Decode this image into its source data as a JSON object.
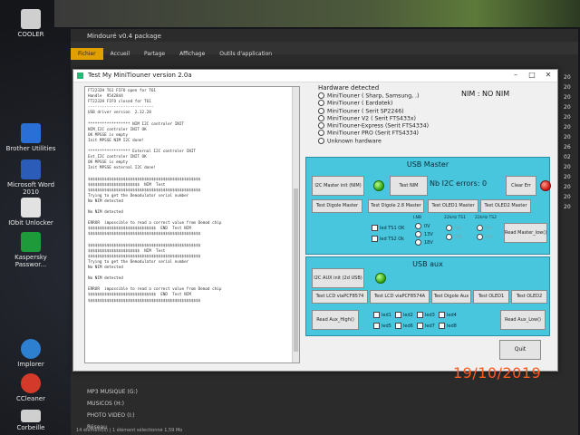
{
  "desktop": {
    "icons": [
      {
        "label": "COOLER",
        "color": "#cfcfcf"
      },
      {
        "label": "Brother Utilities",
        "color": "#2a6fd6"
      },
      {
        "label": "Microsoft Word 2010",
        "color": "#2b5db8"
      },
      {
        "label": "IObit Unlocker",
        "color": "#e2e2e2"
      },
      {
        "label": "Kaspersky Passwor...",
        "color": "#1e9a3a"
      },
      {
        "label": "Implorer",
        "color": "#2d7fd0"
      },
      {
        "label": "CCleaner",
        "color": "#d43a2a"
      },
      {
        "label": "Corbeille",
        "color": "#cfcfcf"
      }
    ]
  },
  "explorer": {
    "title": "Mindouré v0.4 package",
    "tabs": [
      "Fichier",
      "Accueil",
      "Partage",
      "Affichage",
      "Outils d'application"
    ],
    "list": [
      "MP3 MUSIQUE (G:)",
      "MUSICOS (H:)",
      "PHOTO VIDEO (I:)",
      "Réseau"
    ],
    "status": "14 élément(s)  |  1 élément sélectionné  1,59 Mo",
    "right_column": [
      "20",
      "20",
      "20",
      "20",
      "20",
      "20",
      "20",
      "26",
      "02",
      "20",
      "20",
      "20",
      "20",
      "20"
    ]
  },
  "app": {
    "title": "Test My MiniTiouner version 2.0a",
    "log_lines": [
      "FT2232H T61 FIFO open for T61",
      "Handle  9542844",
      "FT2232H FIFO closed for T61",
      "----------------------------",
      "USB driver version  2.12.28",
      "",
      "****************** NIM I2C controler INIT",
      "NIM_I2C controler INIT OK",
      "OK MPSSE is empty",
      "Init MPSSE NIM I2C done!",
      "",
      "****************** External I2C controler INIT",
      "Ext_I2C controler INIT OK",
      "OK MPSSE is empty",
      "Init MPSSE external I2C done!",
      "",
      "$$$$$$$$$$$$$$$$$$$$$$$$$$$$$$$$$$$$$$$$$$$$$$$$",
      "$$$$$$$$$$$$$$$$$$$$$$  NIM  Test",
      "$$$$$$$$$$$$$$$$$$$$$$$$$$$$$$$$$$$$$$$$$$$$$$$$",
      "Trying to get the Demodulator serial number",
      "No NIM detected",
      "",
      "No NIM detected",
      "",
      "ERROR  impossible to read a correct value from Demod chip",
      "$$$$$$$$$$$$$$$$$$$$$$$$$$$$$  END  Test NIM",
      "$$$$$$$$$$$$$$$$$$$$$$$$$$$$$$$$$$$$$$$$$$$$$$$$",
      "",
      "$$$$$$$$$$$$$$$$$$$$$$$$$$$$$$$$$$$$$$$$$$$$$$$$",
      "$$$$$$$$$$$$$$$$$$$$$$  NIM  Test",
      "$$$$$$$$$$$$$$$$$$$$$$$$$$$$$$$$$$$$$$$$$$$$$$$$",
      "Trying to get the Demodulator serial number",
      "No NIM detected",
      "",
      "No NIM detected",
      "",
      "ERROR  impossible to read a correct value from Demod chip",
      "$$$$$$$$$$$$$$$$$$$$$$$$$$$$$  END  Test NIM",
      "$$$$$$$$$$$$$$$$$$$$$$$$$$$$$$$$$$$$$$$$$$$$$$$$"
    ],
    "hardware": {
      "label": "Hardware detected",
      "options": [
        "MiniTiouner ( Sharp, Samsung, .)",
        "MiniTiouner ( Eardatek)",
        "MiniTiouner ( Serit SP2246)",
        "MiniTiouner V2 ( Serit FTS433x)",
        "MiniTiouner-Express (Serit FTS4334)",
        "MiniTiouner PRO  (Serit FTS4334)",
        "Unknown hardware"
      ]
    },
    "nim_status": "NIM : NO NIM",
    "usb_master": {
      "title": "USB Master",
      "i2c_master_btn": "I2C Master init (NIM)",
      "test_nim_btn": "Test NIM",
      "errors_label": "Nb I2C errors:",
      "errors_value": "0",
      "clear_btn": "Clear Err",
      "test_digole28": "Test Digole Master",
      "test_digole28b": "Test Digole 2.8 Master",
      "test_oled1": "Test OLED1 Master",
      "test_oled2": "Test OLED2 Master",
      "led_ts1": "led TS1 OK",
      "led_ts2": "led TS2 Ok",
      "lnb_label": "LNB",
      "lnb_options": [
        "0V",
        "13V",
        "18V"
      ],
      "khz_ts1_label": "22kHz TS1",
      "khz_ts2_label": "22kHz TS2",
      "onoff": [
        "On",
        "Off"
      ],
      "read_master_low": "Read Master_low()"
    },
    "usb_aux": {
      "title": "USB aux",
      "i2c_aux_btn": "I2C AUX init (2d USB)",
      "test_lcd_8574": "Test LCD  viaPCF8574",
      "test_lcd_8574a": "Test LCD  viaPCF8574A",
      "test_digole_aux": "Test Digole Aux",
      "test_oled1": "Test OLED1",
      "test_oled2": "Test OLED2",
      "read_aux_high": "Read Aux_High()",
      "read_aux_low": "Read Aux_Low()",
      "leds": [
        "led1",
        "led2",
        "led3",
        "led4",
        "led5",
        "led6",
        "led7",
        "led8"
      ]
    },
    "quit_btn": "Quit"
  },
  "datestamp": "19/10/2019",
  "colors": {
    "panel": "#48c6de",
    "led_green": "#2fa010",
    "led_red": "#d01010",
    "datestamp": "#ff5a1e"
  }
}
